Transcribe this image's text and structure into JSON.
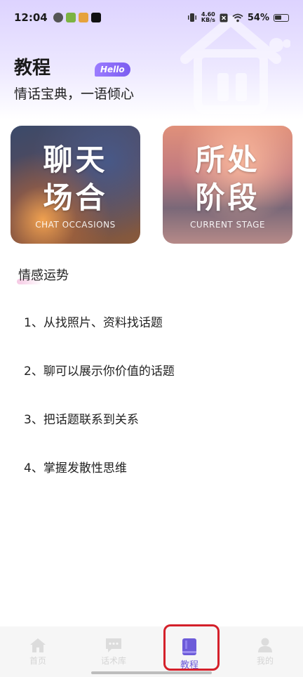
{
  "status_bar": {
    "time": "12:04",
    "net_speed_value": "4.60",
    "net_speed_unit": "KB/s",
    "battery": "54%"
  },
  "header": {
    "title": "教程",
    "badge": "Hello",
    "subtitle": "情话宝典，一语倾心"
  },
  "cards": [
    {
      "title_line1": "聊天",
      "title_line2": "场合",
      "subtitle": "CHAT OCCASIONS"
    },
    {
      "title_line1": "所处",
      "title_line2": "阶段",
      "subtitle": "CURRENT STAGE"
    }
  ],
  "section": {
    "title": "情感运势",
    "items": [
      "1、从找照片、资料找话题",
      "2、聊可以展示你价值的话题",
      "3、把话题联系到关系",
      "4、掌握发散性思维"
    ]
  },
  "bottom_nav": {
    "items": [
      {
        "label": "首页",
        "icon": "home-icon",
        "active": false
      },
      {
        "label": "话术库",
        "icon": "chat-icon",
        "active": false
      },
      {
        "label": "教程",
        "icon": "book-icon",
        "active": true
      },
      {
        "label": "我的",
        "icon": "user-icon",
        "active": false
      }
    ]
  },
  "colors": {
    "accent": "#6d5cd9",
    "highlight_border": "#d4202a",
    "inactive_nav": "#d5d5d5"
  }
}
